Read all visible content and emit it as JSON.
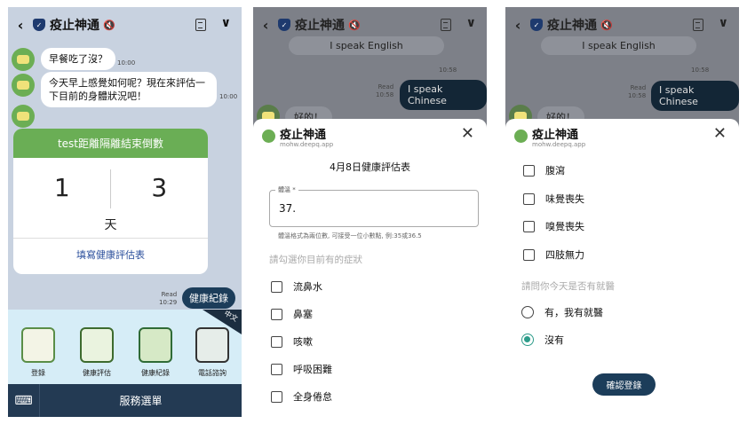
{
  "app": {
    "title": "疫止神通",
    "domain": "mohw.deepq.app"
  },
  "chat": {
    "msg1": "早餐吃了沒？",
    "msg1_time": "10:00",
    "msg2_line1": "今天早上感覺如何呢？現在來評估一",
    "msg2_line2": "下目前的身體狀況吧！",
    "msg2_time": "10:00",
    "card_title": "test距離隔離結束倒數",
    "count_left": "1",
    "count_right": "3",
    "count_unit": "天",
    "card_link": "填寫健康評估表",
    "read_label": "Read",
    "sent_time": "10:29",
    "sent_msg": "健康紀錄"
  },
  "menu": {
    "lang": "中文",
    "items": [
      "登錄",
      "健康評估",
      "健康紀錄",
      "電話諮詢"
    ],
    "bar_label": "服務選單",
    "keyboard_icon": "keyboard-icon"
  },
  "panel2": {
    "prev_msg": "I speak English",
    "prev_time": "10:58",
    "read_label": "Read",
    "sent_time": "10:58",
    "sent_msg": "I speak Chinese",
    "bot_reply": "好的！",
    "form_title": "4月8日健康評估表",
    "temp_label": "體溫 *",
    "temp_value": "37.",
    "temp_hint": "體溫格式為兩位數, 可接受一位小數點, 例:35或36.5",
    "symptom_prompt": "請勾選你目前有的症狀",
    "symptoms": [
      "流鼻水",
      "鼻塞",
      "咳嗽",
      "呼吸困難",
      "全身倦怠"
    ]
  },
  "panel3": {
    "symptoms": [
      "腹瀉",
      "味覺喪失",
      "嗅覺喪失",
      "四肢無力"
    ],
    "visit_prompt": "請問你今天是否有就醫",
    "options": [
      "有，我有就醫",
      "沒有"
    ],
    "selected": "沒有",
    "submit": "確認登錄"
  }
}
